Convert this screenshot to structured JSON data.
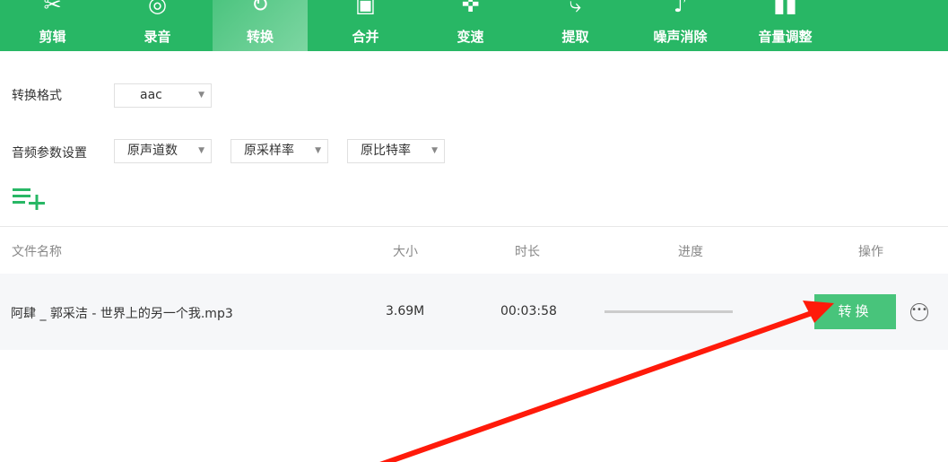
{
  "toolbar": {
    "tabs": [
      {
        "label": "剪辑",
        "icon": "scissors-icon",
        "glyph": "✂"
      },
      {
        "label": "录音",
        "icon": "microphone-icon",
        "glyph": "◎"
      },
      {
        "label": "转换",
        "icon": "convert-icon",
        "glyph": "↻"
      },
      {
        "label": "合并",
        "icon": "merge-icon",
        "glyph": "▣"
      },
      {
        "label": "变速",
        "icon": "speed-icon",
        "glyph": "✜"
      },
      {
        "label": "提取",
        "icon": "extract-icon",
        "glyph": "⤷"
      },
      {
        "label": "噪声消除",
        "icon": "noise-icon",
        "glyph": "♪"
      },
      {
        "label": "音量调整",
        "icon": "volume-icon",
        "glyph": "▮▮"
      }
    ],
    "active": "转换"
  },
  "settings": {
    "format_label": "转换格式",
    "format_value": "aac",
    "audio_label": "音频参数设置",
    "channels": "原声道数",
    "sample_rate": "原采样率",
    "bitrate": "原比特率"
  },
  "table": {
    "headers": {
      "name": "文件名称",
      "size": "大小",
      "duration": "时长",
      "progress": "进度",
      "action": "操作"
    },
    "rows": [
      {
        "name": "阿肆 _ 郭采洁 - 世界上的另一个我.mp3",
        "size": "3.69M",
        "duration": "00:03:58",
        "progress": 0,
        "button": "转换"
      }
    ]
  },
  "colors": {
    "brand": "#28b765",
    "button": "#48c47b",
    "arrow": "#ff1a0a"
  }
}
